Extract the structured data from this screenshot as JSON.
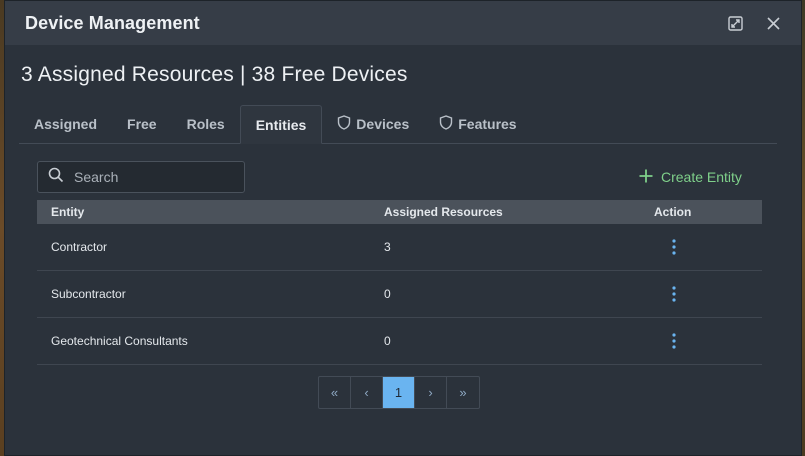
{
  "modal": {
    "title": "Device Management"
  },
  "summary": "3 Assigned Resources | 38 Free Devices",
  "tabs": [
    {
      "label": "Assigned",
      "icon": null,
      "active": false
    },
    {
      "label": "Free",
      "icon": null,
      "active": false
    },
    {
      "label": "Roles",
      "icon": null,
      "active": false
    },
    {
      "label": "Entities",
      "icon": null,
      "active": true
    },
    {
      "label": "Devices",
      "icon": "shield-icon",
      "active": false
    },
    {
      "label": "Features",
      "icon": "shield-icon",
      "active": false
    }
  ],
  "search": {
    "placeholder": "Search",
    "value": ""
  },
  "create_button": {
    "label": "Create Entity",
    "icon": "plus-icon"
  },
  "table": {
    "columns": [
      "Entity",
      "Assigned Resources",
      "Action"
    ],
    "rows": [
      {
        "entity": "Contractor",
        "assigned": "3"
      },
      {
        "entity": "Subcontractor",
        "assigned": "0"
      },
      {
        "entity": "Geotechnical Consultants",
        "assigned": "0"
      }
    ]
  },
  "pagination": {
    "first": "«",
    "prev": "‹",
    "current": "1",
    "next": "›",
    "last": "»"
  },
  "colors": {
    "accent_green": "#7fd08a",
    "accent_blue": "#6ab4f0",
    "modal_bg": "#2b323b",
    "header_bg": "#363d47"
  }
}
